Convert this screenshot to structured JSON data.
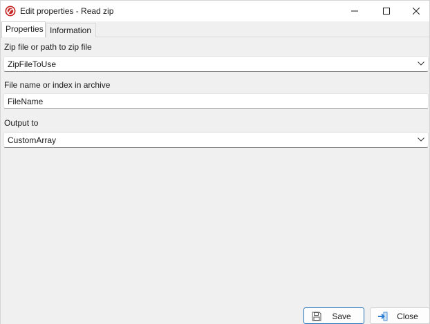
{
  "window": {
    "title": "Edit properties - Read zip",
    "app_icon": "app-logo-icon",
    "controls": [
      "minimize-icon",
      "maximize-icon",
      "close-icon"
    ]
  },
  "tabs": [
    {
      "label": "Properties",
      "active": true
    },
    {
      "label": "Information",
      "active": false
    }
  ],
  "form": {
    "zip_path": {
      "label": "Zip file or path to zip file",
      "value": "ZipFileToUse"
    },
    "file_name": {
      "label": "File name or index in archive",
      "value": "FileName"
    },
    "output": {
      "label": "Output to",
      "value": "CustomArray"
    }
  },
  "footer": {
    "save": {
      "label": "Save",
      "icon": "floppy-disk-icon"
    },
    "close": {
      "label": "Close",
      "icon": "exit-arrow-icon"
    }
  },
  "colors": {
    "accent": "#1f6fb8",
    "app_icon_red": "#c62828",
    "background": "#f0f0f0"
  }
}
